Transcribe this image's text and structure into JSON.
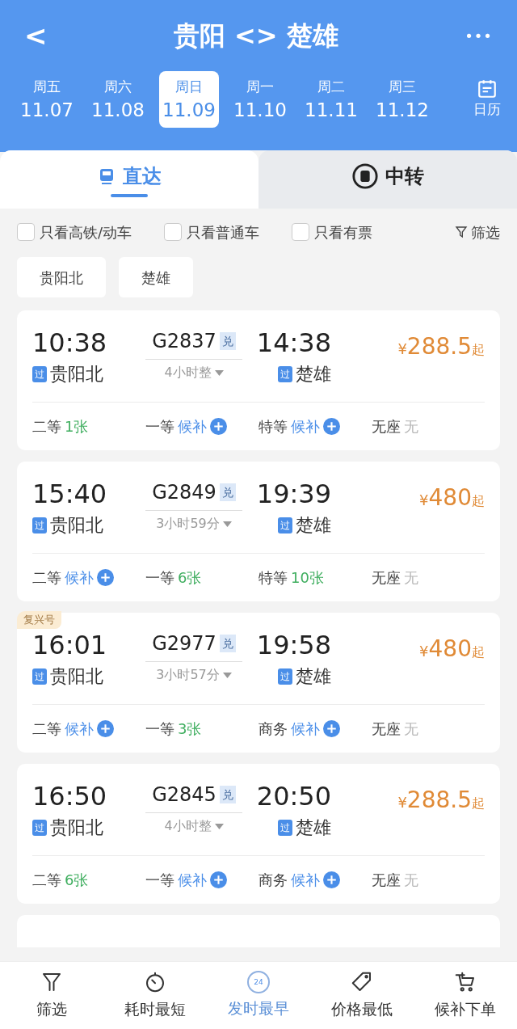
{
  "header": {
    "back": "<",
    "title": "贵阳 <> 楚雄",
    "more": "•••"
  },
  "dates": [
    {
      "weekday": "周五",
      "date": "11.07",
      "selected": false
    },
    {
      "weekday": "周六",
      "date": "11.08",
      "selected": false
    },
    {
      "weekday": "周日",
      "date": "11.09",
      "selected": true
    },
    {
      "weekday": "周一",
      "date": "11.10",
      "selected": false
    },
    {
      "weekday": "周二",
      "date": "11.11",
      "selected": false
    },
    {
      "weekday": "周三",
      "date": "11.12",
      "selected": false
    }
  ],
  "calendar": {
    "label": "日历"
  },
  "mode_tabs": [
    {
      "label": "直达",
      "selected": true
    },
    {
      "label": "中转",
      "selected": false
    }
  ],
  "filters": [
    {
      "label": "只看高铁/动车",
      "checked": false
    },
    {
      "label": "只看普通车",
      "checked": false
    },
    {
      "label": "只看有票",
      "checked": false
    }
  ],
  "filter_button": "筛选",
  "stations": [
    "贵阳北",
    "楚雄"
  ],
  "trains": [
    {
      "depart": "10:38",
      "number": "G2837",
      "badge": "兑",
      "arrive": "14:38",
      "price_symbol": "¥",
      "price": "288.5",
      "price_suffix": "起",
      "from_mark": "过",
      "from": "贵阳北",
      "duration": "4小时整",
      "to_mark": "过",
      "to": "楚雄",
      "seats": [
        {
          "class": "二等",
          "kind": "count",
          "status": "1张"
        },
        {
          "class": "一等",
          "kind": "waitlist",
          "status": "候补"
        },
        {
          "class": "特等",
          "kind": "waitlist",
          "status": "候补"
        },
        {
          "class": "无座",
          "kind": "none",
          "status": "无"
        }
      ]
    },
    {
      "depart": "15:40",
      "number": "G2849",
      "badge": "兑",
      "arrive": "19:39",
      "price_symbol": "¥",
      "price": "480",
      "price_suffix": "起",
      "from_mark": "过",
      "from": "贵阳北",
      "duration": "3小时59分",
      "to_mark": "过",
      "to": "楚雄",
      "seats": [
        {
          "class": "二等",
          "kind": "waitlist",
          "status": "候补"
        },
        {
          "class": "一等",
          "kind": "count",
          "status": "6张"
        },
        {
          "class": "特等",
          "kind": "count",
          "status": "10张"
        },
        {
          "class": "无座",
          "kind": "none",
          "status": "无"
        }
      ]
    },
    {
      "tag": "复兴号",
      "depart": "16:01",
      "number": "G2977",
      "badge": "兑",
      "arrive": "19:58",
      "price_symbol": "¥",
      "price": "480",
      "price_suffix": "起",
      "from_mark": "过",
      "from": "贵阳北",
      "duration": "3小时57分",
      "to_mark": "过",
      "to": "楚雄",
      "seats": [
        {
          "class": "二等",
          "kind": "waitlist",
          "status": "候补"
        },
        {
          "class": "一等",
          "kind": "count",
          "status": "3张"
        },
        {
          "class": "商务",
          "kind": "waitlist",
          "status": "候补"
        },
        {
          "class": "无座",
          "kind": "none",
          "status": "无"
        }
      ]
    },
    {
      "depart": "16:50",
      "number": "G2845",
      "badge": "兑",
      "arrive": "20:50",
      "price_symbol": "¥",
      "price": "288.5",
      "price_suffix": "起",
      "from_mark": "过",
      "from": "贵阳北",
      "duration": "4小时整",
      "to_mark": "过",
      "to": "楚雄",
      "seats": [
        {
          "class": "二等",
          "kind": "count",
          "status": "6张"
        },
        {
          "class": "一等",
          "kind": "waitlist",
          "status": "候补"
        },
        {
          "class": "商务",
          "kind": "waitlist",
          "status": "候补"
        },
        {
          "class": "无座",
          "kind": "none",
          "status": "无"
        }
      ]
    }
  ],
  "bottom_nav": [
    {
      "kind": "filter",
      "label": "筛选",
      "selected": false
    },
    {
      "kind": "timer",
      "label": "耗时最短",
      "selected": false
    },
    {
      "kind": "clock24",
      "label": "发时最早",
      "icon_text": "24",
      "selected": true
    },
    {
      "kind": "tag",
      "label": "价格最低",
      "selected": false
    },
    {
      "kind": "cart",
      "label": "候补下单",
      "selected": false
    }
  ]
}
